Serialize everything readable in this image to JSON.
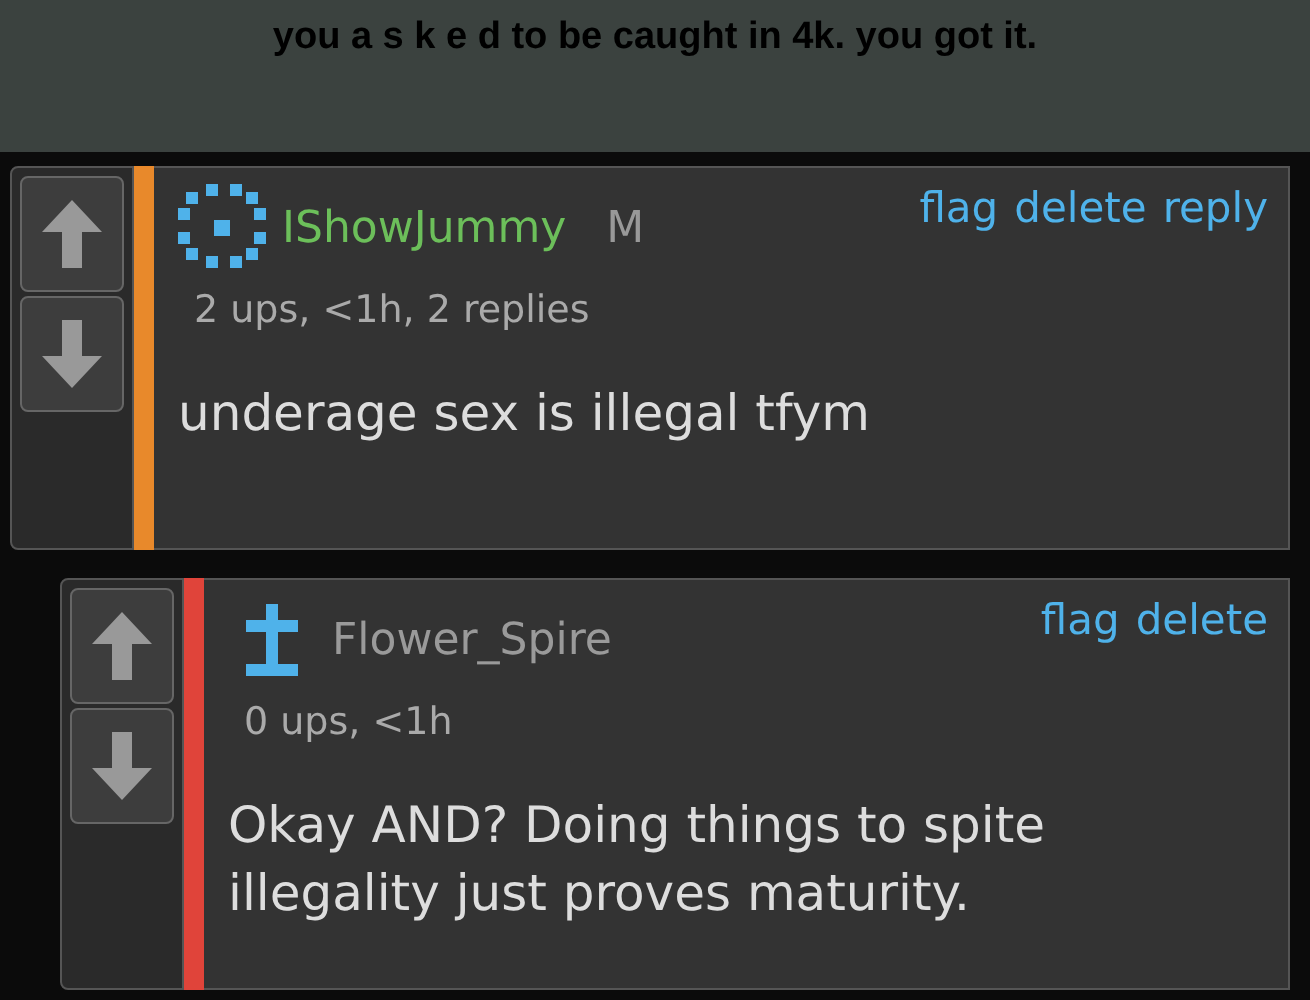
{
  "caption": "you a s k e d to be caught in 4k. you got it.",
  "comments": [
    {
      "kind": "dots",
      "user": {
        "name": "IShowJummy",
        "color": "#6cbf5a"
      },
      "badge": "M",
      "color": "#e8892b",
      "meta": "2 ups, <1h, 2 replies",
      "actions": [
        "flag",
        "delete",
        "reply"
      ],
      "text": "underage sex is illegal tfym",
      "children": [
        {
          "kind": "cross",
          "user": {
            "name": "Flower_Spire",
            "color": "#9a9a9a"
          },
          "color": "#e0443a",
          "meta": "0 ups, <1h",
          "actions": [
            "flag",
            "delete"
          ],
          "text": "Okay AND? Doing things to spite illegality just proves maturity."
        }
      ]
    }
  ]
}
